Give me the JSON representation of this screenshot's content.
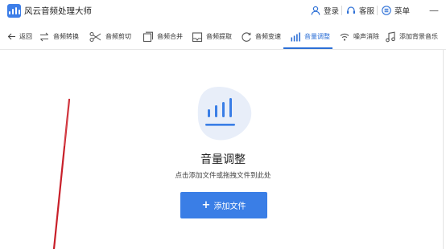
{
  "titlebar": {
    "app_title": "风云音频处理大师",
    "login_label": "登录",
    "service_label": "客服",
    "menu_label": "菜单",
    "minimize_glyph": "—"
  },
  "toolbar": {
    "back_label": "返回",
    "tools": [
      {
        "label": "音频转换",
        "icon": "convert-icon"
      },
      {
        "label": "音频剪切",
        "icon": "scissors-icon"
      },
      {
        "label": "音频合并",
        "icon": "merge-icon"
      },
      {
        "label": "音频提取",
        "icon": "extract-icon"
      },
      {
        "label": "音频变速",
        "icon": "speed-icon"
      },
      {
        "label": "音量调整",
        "icon": "volume-bars-icon",
        "active": true
      },
      {
        "label": "噪声消除",
        "icon": "noise-icon"
      },
      {
        "label": "添加背景音乐",
        "icon": "music-note-icon"
      }
    ]
  },
  "main": {
    "title": "音量调整",
    "hint": "点击添加文件或拖拽文件到此处",
    "add_button_label": "添加文件",
    "add_button_plus": "+"
  },
  "colors": {
    "accent": "#3a7ee6",
    "active_tab": "#2c6fd6",
    "hero_blob": "#e8eef9",
    "streak": "#c8202a"
  }
}
